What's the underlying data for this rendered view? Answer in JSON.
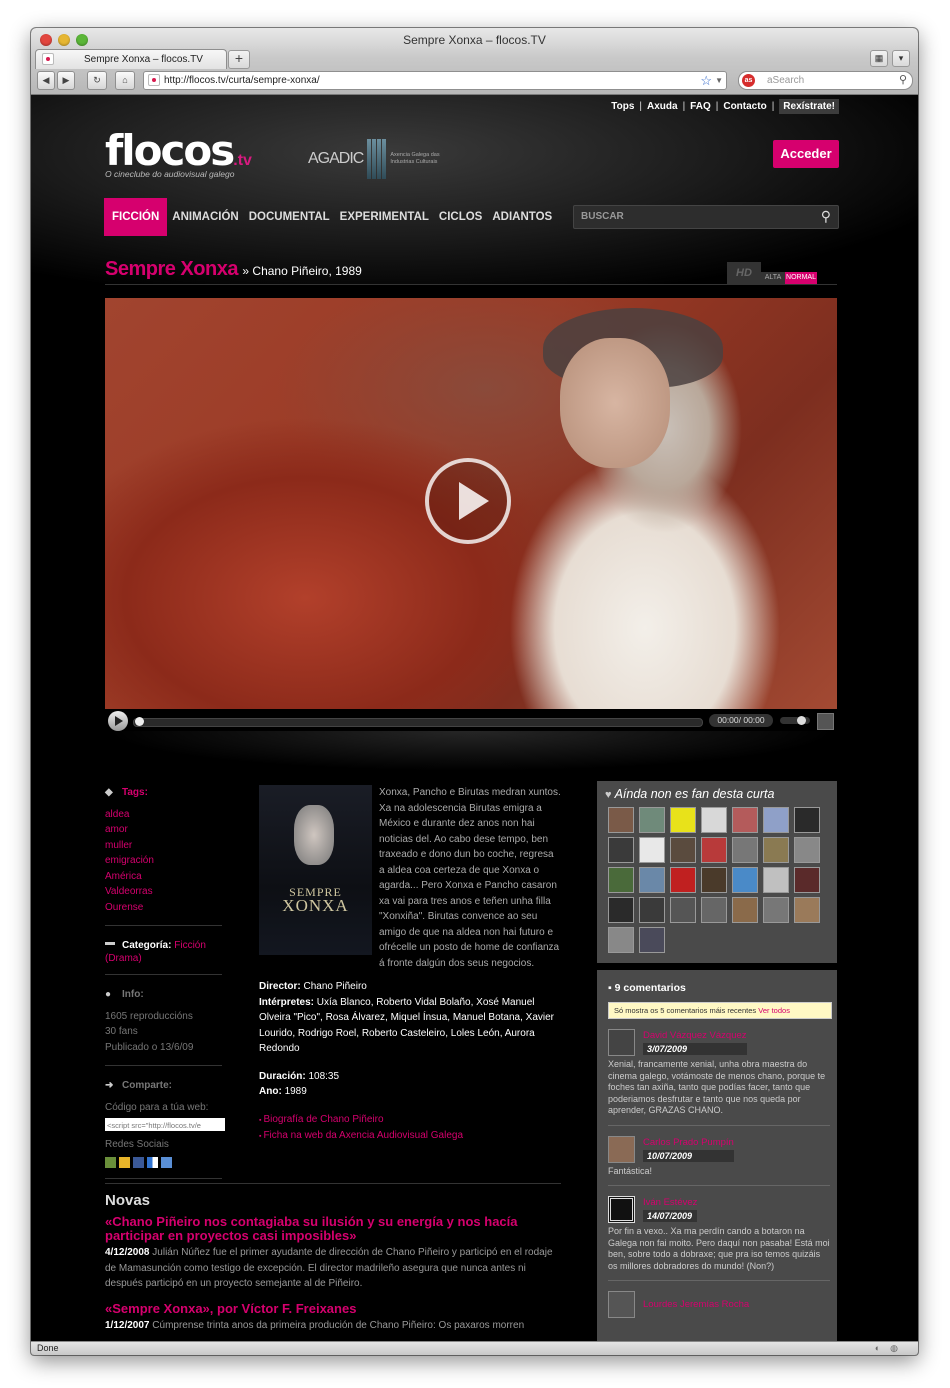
{
  "browser": {
    "window_title": "Sempre Xonxa – flocos.TV",
    "tab_label": "Sempre Xonxa – flocos.TV",
    "url": "http://flocos.tv/curta/sempre-xonxa/",
    "search_placeholder": "aSearch",
    "search_engine_badge": "as",
    "status": "Done"
  },
  "site": {
    "top_links": [
      "Tops",
      "Axuda",
      "FAQ",
      "Contacto",
      "Rexístrate!"
    ],
    "logo_text": "flocos",
    "logo_tv": ".tv",
    "logo_tagline": "O cineclube do audiovisual galego",
    "partner_name": "AGADIC",
    "partner_tagline": "Axencia Galega das Industrias Culturais",
    "login_button": "Acceder",
    "menu": [
      "FICCIÓN",
      "ANIMACIÓN",
      "DOCUMENTAL",
      "EXPERIMENTAL",
      "CICLOS",
      "ADIANTOS"
    ],
    "search_placeholder": "BUSCAR"
  },
  "film": {
    "title": "Sempre Xonxa",
    "subtitle": "» Chano Piñeiro, 1989",
    "quality": {
      "hd": "HD",
      "alta": "ALTA",
      "normal": "NORMAL",
      "selected": "NORMAL"
    },
    "player_time": "00:00/ 00:00",
    "progress": 0
  },
  "sidebar": {
    "tags_label": "Tags:",
    "tags": [
      "aldea",
      "amor",
      "muller",
      "emigración",
      "América",
      "Valdeorras",
      "Ourense"
    ],
    "categoria_label": "Categoría:",
    "categoria_value": "Ficción",
    "categoria_extra": "(Drama)",
    "info_label": "Info:",
    "info": [
      "1605 reproduccións",
      "30 fans",
      "Publicado o 13/6/09"
    ],
    "comparte_label": "Comparte:",
    "embed_label": "Código para a túa web:",
    "embed_code": "<script src=\"http://flocos.tv/e",
    "social_label": "Redes Sociais"
  },
  "synopsis": {
    "text": "Xonxa, Pancho e Birutas medran xuntos. Xa na adolescencia Birutas emigra a México e durante dez anos non hai noticias del. Ao cabo dese tempo, ben traxeado e dono dun bo coche, regresa a aldea coa certeza de que Xonxa o agarda... Pero Xonxa e Pancho casaron xa vai para tres anos e teñen unha filla \"Xonxiña\". Birutas convence ao seu amigo de que na aldea non hai futuro e ofrécelle un posto de home de confianza á fronte dalgún dos seus negocios.",
    "director_label": "Director:",
    "director": "Chano Piñeiro",
    "interpretes_label": "Intérpretes:",
    "interpretes": "Uxía Blanco, Roberto Vidal Bolaño, Xosé Manuel Olveira \"Pico\", Rosa Álvarez, Miquel Ínsua, Manuel Botana, Xavier Lourido, Rodrigo Roel, Roberto Casteleiro, Loles León, Aurora Redondo",
    "duracion_label": "Duración:",
    "duracion": "108:35",
    "ano_label": "Ano:",
    "ano": "1989",
    "links": [
      "Biografía de Chano Piñeiro",
      "Ficha na web da Axencia Audiovisual Galega"
    ],
    "poster_title_1": "SEMPRE",
    "poster_title_2": "XONXA"
  },
  "novas": {
    "heading": "Novas",
    "items": [
      {
        "title": "«Chano Piñeiro nos contagiaba su ilusión y su energía y nos hacía participar en proyectos casi imposibles»",
        "date": "4/12/2008",
        "text": "Julián Núñez fue el primer ayudante de dirección de Chano Piñeiro y participó en el rodaje de Mamasunción como testigo de excepción. El director madrileño asegura que nunca antes ni después participó en un proyecto semejante al de Piñeiro."
      },
      {
        "title": "«Sempre Xonxa», por Víctor F. Freixanes",
        "date": "1/12/2007",
        "text": "Cúmprense trinta anos da primeira produción de Chano Piñeiro: Os paxaros morren"
      }
    ]
  },
  "fans": {
    "heading": "Aínda non es fan desta curta",
    "avatar_colors": [
      "#7a5a48",
      "#6f8a7a",
      "#e8e21a",
      "#d8d8d8",
      "#b45b5b",
      "#8fa0c8",
      "#2a2a2a",
      "#3a3a3a",
      "#e8e8e8",
      "#5a4b3e",
      "#b83a3a",
      "#777777",
      "#8a7a52",
      "#888888",
      "#4a6a3a",
      "#6a88a8",
      "#c02020",
      "#4a3a2a",
      "#4a8ac8",
      "#c0c0c0",
      "#5a2a2a",
      "#2a2a2a",
      "#3a3a3a",
      "#555555",
      "#666666",
      "#8a6a4a",
      "#777777",
      "#9a7a5a",
      "#888888",
      "#4a4a5a"
    ]
  },
  "comments": {
    "count_label": "9 comentarios",
    "note_text": "Só mostra os 5 comentarios máis recentes",
    "note_link": "Ver todos",
    "items": [
      {
        "name": "David Vázquez Vázquez",
        "date": "3/07/2009",
        "text": "Xenial, francamente xenial, unha obra maestra do cinema galego, votámoste de menos chano, porque te foches tan axiña, tanto que podías facer, tanto que poderiamos desfrutar e tanto que nos queda por aprender, GRAZAS CHANO."
      },
      {
        "name": "Carlos Prado Pumpín",
        "date": "10/07/2009",
        "text": "Fantástica!"
      },
      {
        "name": "Iván Estévez",
        "date": "14/07/2009",
        "text": "Por fin a vexo.. Xa ma perdín cando a botaron na Galega non fai moito. Pero daquí non pasaba! Está moi ben, sobre todo a dobraxe; que pra iso temos quizáis os millores dobradores do mundo! (Non?)"
      },
      {
        "name": "Lourdes Jeremías Rocha",
        "date": "",
        "text": ""
      }
    ]
  }
}
